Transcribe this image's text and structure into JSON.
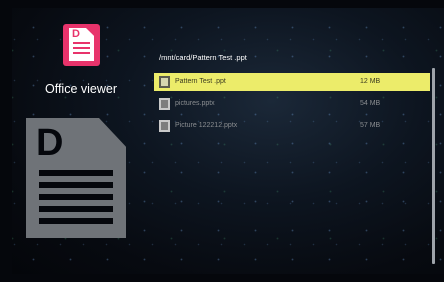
{
  "app": {
    "title": "Office viewer",
    "icon": "office-doc-icon",
    "accent_color": "#e8336b"
  },
  "browser": {
    "path": "/mnt/card/Pattern Test .ppt",
    "files": [
      {
        "name": "Pattern Test .ppt",
        "size": "12  MB",
        "selected": true,
        "icon": "presentation-file-icon"
      },
      {
        "name": "pictures.pptx",
        "size": "54  MB",
        "selected": false,
        "icon": "presentation-file-icon"
      },
      {
        "name": "Picture 122212.pptx",
        "size": "57  MB",
        "selected": false,
        "icon": "presentation-file-icon"
      }
    ],
    "selection_color": "#ecec6a"
  }
}
